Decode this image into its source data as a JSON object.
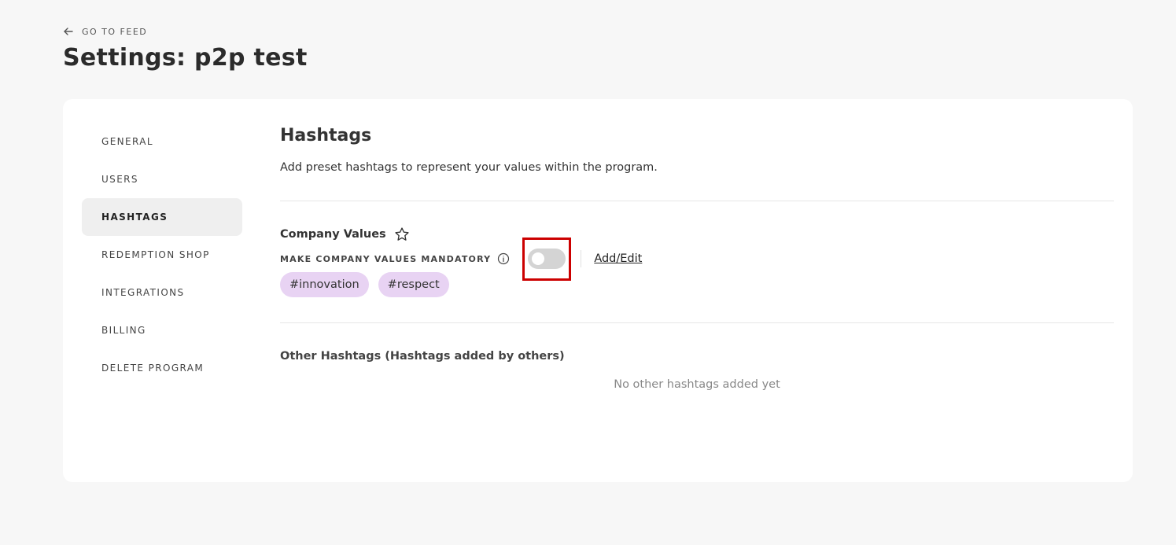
{
  "header": {
    "back_label": "GO TO FEED",
    "title": "Settings: p2p test"
  },
  "sidebar": {
    "items": [
      {
        "label": "GENERAL",
        "active": false
      },
      {
        "label": "USERS",
        "active": false
      },
      {
        "label": "HASHTAGS",
        "active": true
      },
      {
        "label": "REDEMPTION SHOP",
        "active": false
      },
      {
        "label": "INTEGRATIONS",
        "active": false
      },
      {
        "label": "BILLING",
        "active": false
      },
      {
        "label": "DELETE PROGRAM",
        "active": false
      }
    ]
  },
  "main": {
    "title": "Hashtags",
    "description": "Add preset hashtags to represent your values within the program.",
    "company_values": {
      "title": "Company Values",
      "star_icon": "star-outline-icon",
      "mandatory_label": "MAKE COMPANY VALUES MANDATORY",
      "info_icon": "info-circle-icon",
      "mandatory_toggle": false,
      "add_edit_label": "Add/Edit",
      "tags": [
        "#innovation",
        "#respect"
      ]
    },
    "other_hashtags": {
      "title": "Other Hashtags (Hashtags added by others)",
      "empty_text": "No other hashtags added yet"
    }
  },
  "colors": {
    "page_bg": "#f7f7f7",
    "card_bg": "#ffffff",
    "tag_bg": "#e8d3f3",
    "active_nav_bg": "#efefef",
    "toggle_off": "#d4d4d4",
    "highlight_box": "#cc0000"
  }
}
